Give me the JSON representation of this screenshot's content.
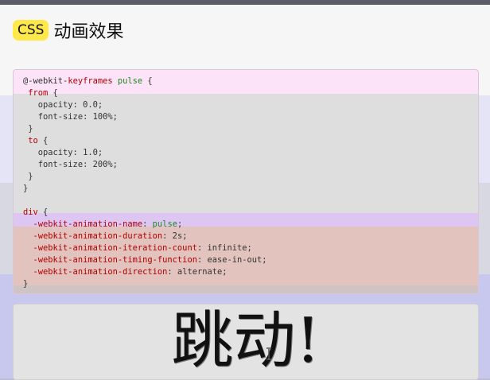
{
  "header": {
    "badge": "CSS",
    "title": "动画效果"
  },
  "code": {
    "lines": [
      [
        [
          "@-webkit-",
          "plain"
        ],
        [
          "keyframes",
          "kw"
        ],
        [
          " ",
          "plain"
        ],
        [
          "pulse",
          "g"
        ],
        [
          " {",
          "plain"
        ]
      ],
      [
        [
          " ",
          "plain"
        ],
        [
          "from",
          "kw"
        ],
        [
          " {",
          "plain"
        ]
      ],
      [
        [
          "   opacity: 0.0;",
          "plain"
        ]
      ],
      [
        [
          "   font-size: 100%;",
          "plain"
        ]
      ],
      [
        [
          " }",
          "plain"
        ]
      ],
      [
        [
          " ",
          "plain"
        ],
        [
          "to",
          "kw"
        ],
        [
          " {",
          "plain"
        ]
      ],
      [
        [
          "   opacity: 1.0;",
          "plain"
        ]
      ],
      [
        [
          "   font-size: 200%;",
          "plain"
        ]
      ],
      [
        [
          " }",
          "plain"
        ]
      ],
      [
        [
          "}",
          "plain"
        ]
      ],
      [
        [
          "",
          "plain"
        ]
      ],
      [
        [
          "div",
          "kw"
        ],
        [
          " {",
          "plain"
        ]
      ],
      [
        [
          "  ",
          "plain"
        ],
        [
          "-webkit-animation-name",
          "p"
        ],
        [
          ": ",
          "plain"
        ],
        [
          "pulse",
          "g"
        ],
        [
          ";",
          "plain"
        ]
      ],
      [
        [
          "  ",
          "plain"
        ],
        [
          "-webkit-animation-duration",
          "p"
        ],
        [
          ": 2s;",
          "plain"
        ]
      ],
      [
        [
          "  ",
          "plain"
        ],
        [
          "-webkit-animation-iteration-count",
          "p"
        ],
        [
          ": infinite;",
          "plain"
        ]
      ],
      [
        [
          "  ",
          "plain"
        ],
        [
          "-webkit-animation-timing-function",
          "p"
        ],
        [
          ": ease-in-out;",
          "plain"
        ]
      ],
      [
        [
          "  ",
          "plain"
        ],
        [
          "-webkit-animation-direction",
          "p"
        ],
        [
          ": alternate;",
          "plain"
        ]
      ],
      [
        [
          "}",
          "plain"
        ]
      ]
    ]
  },
  "demo": {
    "text": "跳动!"
  },
  "icons": {
    "cursor": "text-cursor-icon"
  }
}
